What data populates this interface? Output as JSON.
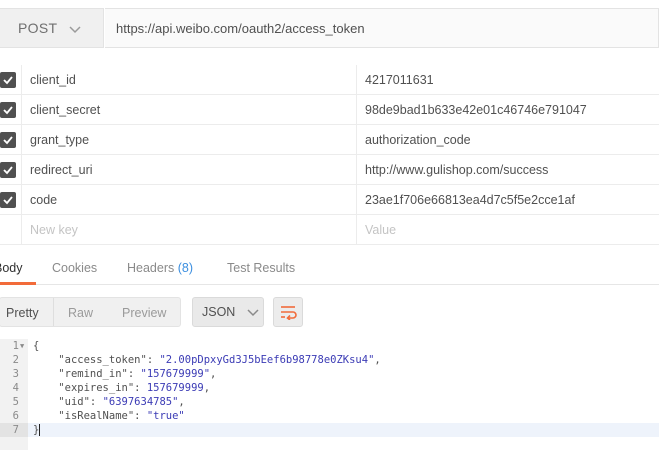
{
  "request": {
    "method": "POST",
    "url": "https://api.weibo.com/oauth2/access_token"
  },
  "params": [
    {
      "enabled": true,
      "key": "client_id",
      "value": "4217011631"
    },
    {
      "enabled": true,
      "key": "client_secret",
      "value": "98de9bad1b633e42e01c46746e791047"
    },
    {
      "enabled": true,
      "key": "grant_type",
      "value": "authorization_code"
    },
    {
      "enabled": true,
      "key": "redirect_uri",
      "value": "http://www.gulishop.com/success"
    },
    {
      "enabled": true,
      "key": "code",
      "value": "23ae1f706e66813ea4d7c5f5e2cce1af"
    }
  ],
  "new_param": {
    "key_placeholder": "New key",
    "value_placeholder": "Value"
  },
  "response_tabs": {
    "body": "Body",
    "cookies": "Cookies",
    "headers": "Headers",
    "headers_count": "(8)",
    "test_results": "Test Results",
    "active": "Body"
  },
  "view_modes": {
    "pretty": "Pretty",
    "raw": "Raw",
    "preview": "Preview",
    "active": "Pretty"
  },
  "format": {
    "selected": "JSON"
  },
  "code_lines": [
    {
      "n": "1",
      "text": "{"
    },
    {
      "n": "2",
      "key": "\"access_token\"",
      "value": "\"2.00pDpxyGd3J5bEef6b98778e0ZKsu4\"",
      "comma": ","
    },
    {
      "n": "3",
      "key": "\"remind_in\"",
      "value": "\"157679999\"",
      "comma": ","
    },
    {
      "n": "4",
      "key": "\"expires_in\"",
      "value": "157679999",
      "comma": ","
    },
    {
      "n": "5",
      "key": "\"uid\"",
      "value": "\"6397634785\"",
      "comma": ","
    },
    {
      "n": "6",
      "key": "\"isRealName\"",
      "value": "\"true\"",
      "comma": ""
    },
    {
      "n": "7",
      "text": "}"
    }
  ],
  "icons": {
    "method_dropdown": "chevron-down-icon",
    "format_dropdown": "chevron-down-icon",
    "checkbox": "check-icon",
    "wrap": "wrap-lines-icon",
    "fold": "fold-arrow-icon"
  },
  "colors": {
    "accent": "#f26b3a",
    "headers_count": "#3c8fe0",
    "json_string": "#3b3bb5"
  }
}
